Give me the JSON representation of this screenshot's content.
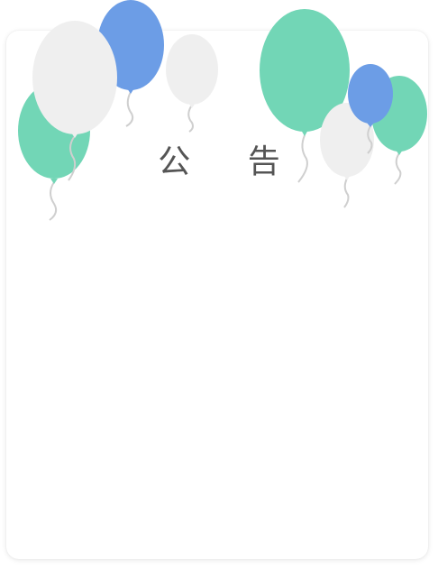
{
  "notice": {
    "title": "公 告",
    "body": ""
  },
  "palette": {
    "green": "#72d6b6",
    "blue": "#6c9de6",
    "white": "#efefef",
    "string": "#cfcfcf",
    "title_color": "#555555"
  },
  "decorations": {
    "icon": "balloon-icon",
    "count": 9
  }
}
